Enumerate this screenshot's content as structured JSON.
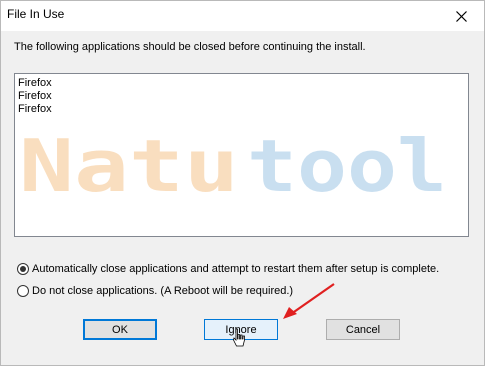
{
  "window": {
    "title": "File In Use"
  },
  "message": "The following applications should be closed before continuing the install.",
  "applications": [
    "Firefox",
    "Firefox",
    "Firefox"
  ],
  "watermark": {
    "part1": "Natu",
    "part2": "tool",
    "color1": "#f9d9b5",
    "color2": "#c4dcef"
  },
  "options": {
    "auto_close": {
      "label": "Automatically close applications and attempt to restart them after setup is complete.",
      "selected": true
    },
    "do_not_close": {
      "label": "Do not close applications. (A Reboot will be required.)",
      "selected": false
    }
  },
  "buttons": {
    "ok": "OK",
    "ignore": "Ignore",
    "cancel": "Cancel"
  },
  "colors": {
    "accent": "#0078d7",
    "annotation_arrow": "#e02020"
  }
}
